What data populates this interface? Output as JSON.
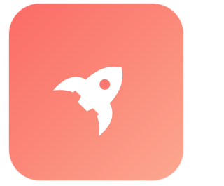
{
  "icon": {
    "name": "rocket-icon",
    "background_colors": [
      "#fb6b66",
      "#fca890"
    ],
    "glyph_color": "#ffffff",
    "window_color": "#f9776f"
  }
}
